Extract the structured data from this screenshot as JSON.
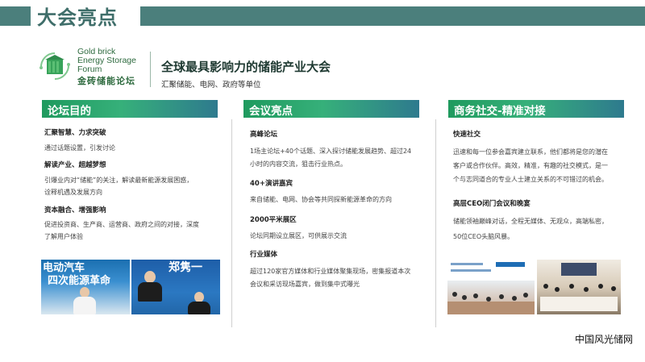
{
  "slide": {
    "title": "大会亮点"
  },
  "brand": {
    "name_en_line1": "Gold brick",
    "name_en_line2": "Energy Storage",
    "name_en_line3": "Forum",
    "name_cn": "金砖储能论坛",
    "headline": "全球最具影响力的储能产业大会",
    "subline": "汇聚储能、电网、政府等单位"
  },
  "columns": [
    {
      "heading": "论坛目的",
      "items": [
        {
          "title": "汇聚智慧、力求突破",
          "text1": "通过话题设置，引发讨论",
          "text2": ""
        },
        {
          "title": "解读产业、超越梦想",
          "text1": "引爆业内对“储能”的关注，解读最新能源发展困惑，",
          "text2": "诠释机遇及发展方向"
        },
        {
          "title": "资本融合、增强影响",
          "text1": "促进投资商、生产商、运营商、政府之间的对接，深度",
          "text2": "了解用户体验"
        }
      ],
      "photo1_text_line1": "电动汽车",
      "photo1_text_line2": "四次能源革命",
      "photo2_text": "郑隽一"
    },
    {
      "heading": "会议亮点",
      "items": [
        {
          "title": "高峰论坛",
          "text1": "1场主论坛+40个话题、深入探讨储能发展趋势、超过24",
          "text2": "小时的内容交流，狙击行业热点。"
        },
        {
          "title": "40+演讲嘉宾",
          "text1": "来自储能、电网、协会等共同探新能源革命的方向",
          "text2": ""
        },
        {
          "title": "2000平米展区",
          "text1": "论坛同期设立展区，可供展示交流",
          "text2": ""
        },
        {
          "title": "行业媒体",
          "text1": "超过120家官方媒体和行业媒体聚集现场，密集报道本次",
          "text2": "会议和采访现场嘉宾，做到集中式曝光"
        }
      ]
    },
    {
      "heading": "商务社交-精准对接",
      "items": [
        {
          "title": "快速社交",
          "text1": "迅速和每一位参会嘉宾建立联系，他们都将是您的潜在",
          "text2": "客户或合作伙伴。高效，精准，有趣的社交模式，是一",
          "text3": "个与志同道合的专业人士建立关系的不可错过的机会。"
        },
        {
          "title": "高层CEO闭门会议和晚宴",
          "text1": "储能领袖巅峰对话，全程无媒体、无观众，高端私密，",
          "text2": "50位CEO头脑风暴。",
          "text3": ""
        }
      ]
    }
  ],
  "watermark": "中国风光储网",
  "colors": {
    "accent": "#4b7f7c",
    "header_green": "#1f9a5e",
    "header_blue": "#2e7a8e"
  }
}
